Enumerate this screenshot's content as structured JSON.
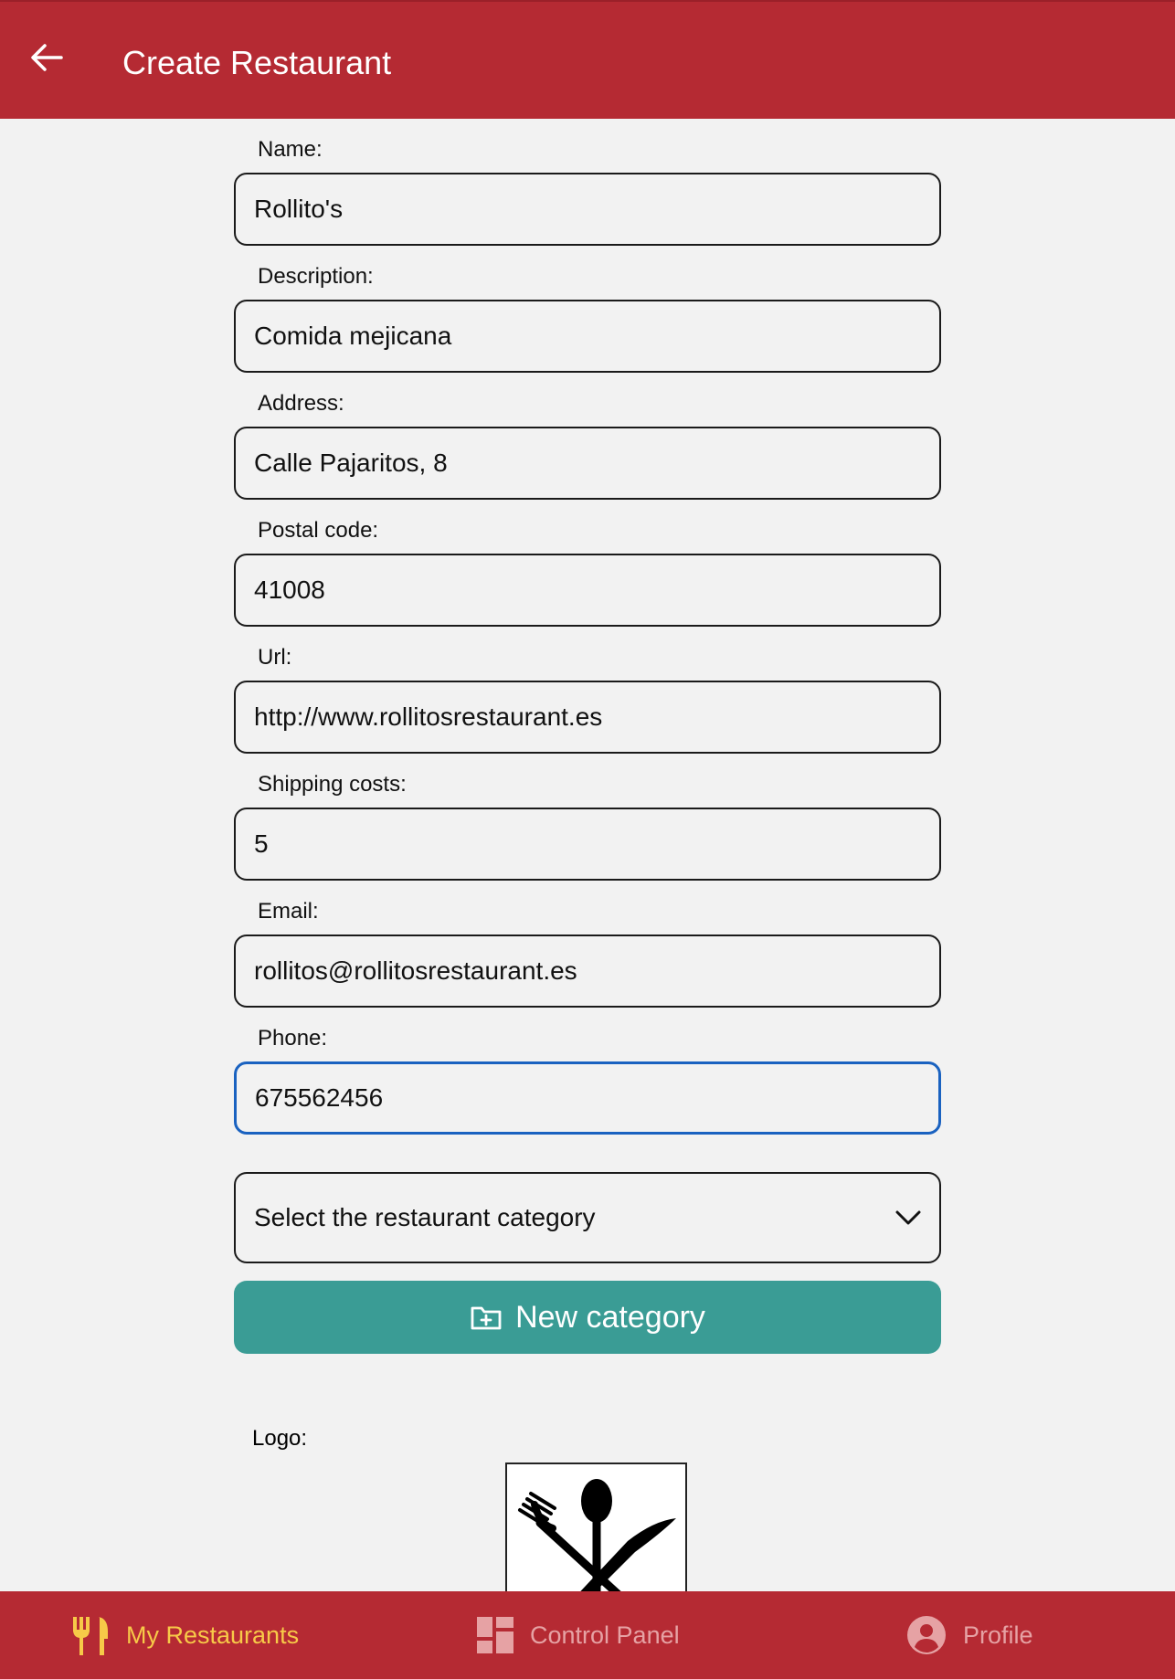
{
  "header": {
    "title": "Create Restaurant",
    "back_icon": "arrow-left-icon"
  },
  "form": {
    "fields": [
      {
        "label": "Name:",
        "value": "Rollito's"
      },
      {
        "label": "Description:",
        "value": "Comida mejicana"
      },
      {
        "label": "Address:",
        "value": "Calle Pajaritos, 8"
      },
      {
        "label": "Postal code:",
        "value": "41008"
      },
      {
        "label": "Url:",
        "value": "http://www.rollitosrestaurant.es"
      },
      {
        "label": "Shipping costs:",
        "value": "5"
      },
      {
        "label": "Email:",
        "value": "rollitos@rollitosrestaurant.es"
      },
      {
        "label": "Phone:",
        "value": "675562456"
      }
    ],
    "category_select": {
      "placeholder": "Select the restaurant category"
    },
    "new_category_button": {
      "label": "New category",
      "icon": "folder-plus-icon"
    },
    "logo_label": "Logo:"
  },
  "bottom_nav": {
    "items": [
      {
        "label": "My Restaurants",
        "icon": "restaurant-icon",
        "active": true
      },
      {
        "label": "Control Panel",
        "icon": "dashboard-icon",
        "active": false
      },
      {
        "label": "Profile",
        "icon": "profile-icon",
        "active": false
      }
    ]
  },
  "colors": {
    "header": "#b52a33",
    "nav_active": "#f7c948",
    "nav_inactive": "#e6a2a4",
    "button": "#3a9c95",
    "focus_border": "#1a62c0"
  }
}
